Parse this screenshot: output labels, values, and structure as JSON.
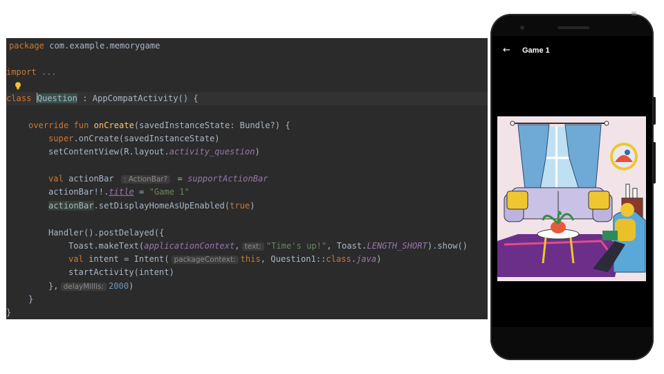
{
  "editor": {
    "package_kw": "package",
    "package_name": " com.example.memorygame",
    "import_kw": "import",
    "import_fold": " ...",
    "class_kw": "class",
    "class_name": "Question",
    "class_rest": " : AppCompatActivity() {",
    "override_kw": "override fun ",
    "oncreate_fn": "onCreate",
    "oncreate_params": "(savedInstanceState: Bundle?) {",
    "super_kw": "super",
    "super_call": ".onCreate(savedInstanceState)",
    "setcontent_call": "setContentView(R.layout.",
    "layout_ref": "activity_question",
    "close_paren": ")",
    "val_kw": "val ",
    "actionbar_var": "actionBar ",
    "actionbar_hint": ": ActionBar?",
    "eq": " = ",
    "support_ref": "supportActionBar",
    "actionbar_title_prefix": "actionBar!!.",
    "title_prop": "title",
    "title_eq": " = ",
    "title_str": "\"Game 1\"",
    "homeup_var": "actionBar",
    "homeup_call": ".setDisplayHomeAsUpEnabled(",
    "true_kw": "true",
    "homeup_close": ")",
    "handler_call": "Handler().postDelayed({",
    "toast_call": "Toast.makeText(",
    "app_ctx": "applicationContext",
    "comma": ",",
    "text_hint": "text:",
    "toast_str": "\"Time's up!\"",
    "toast_mid": ", Toast.",
    "length_short": "LENGTH_SHORT",
    "toast_end": ").show()",
    "intent_decl": "intent = Intent(",
    "package_ctx_hint": "packageContext:",
    "this_kw": "this",
    "intent_mid": ", Question1::",
    "class_ref": "class",
    "dot": ".",
    "java_ref": "java",
    "start_activity": "startActivity(intent)",
    "postdelayed_close": "},",
    "delay_hint": "delayMillis:",
    "delay_value": "2000",
    "brace": "}"
  },
  "phone": {
    "app_title": "Game 1",
    "back_icon": "arrow-left"
  },
  "colors": {
    "editor_bg": "#2b2b2b",
    "keyword": "#cc7832",
    "function": "#ffc66d",
    "string": "#6a8759",
    "number": "#6897bb",
    "field": "#9876aa",
    "default_text": "#a9b7c6"
  }
}
